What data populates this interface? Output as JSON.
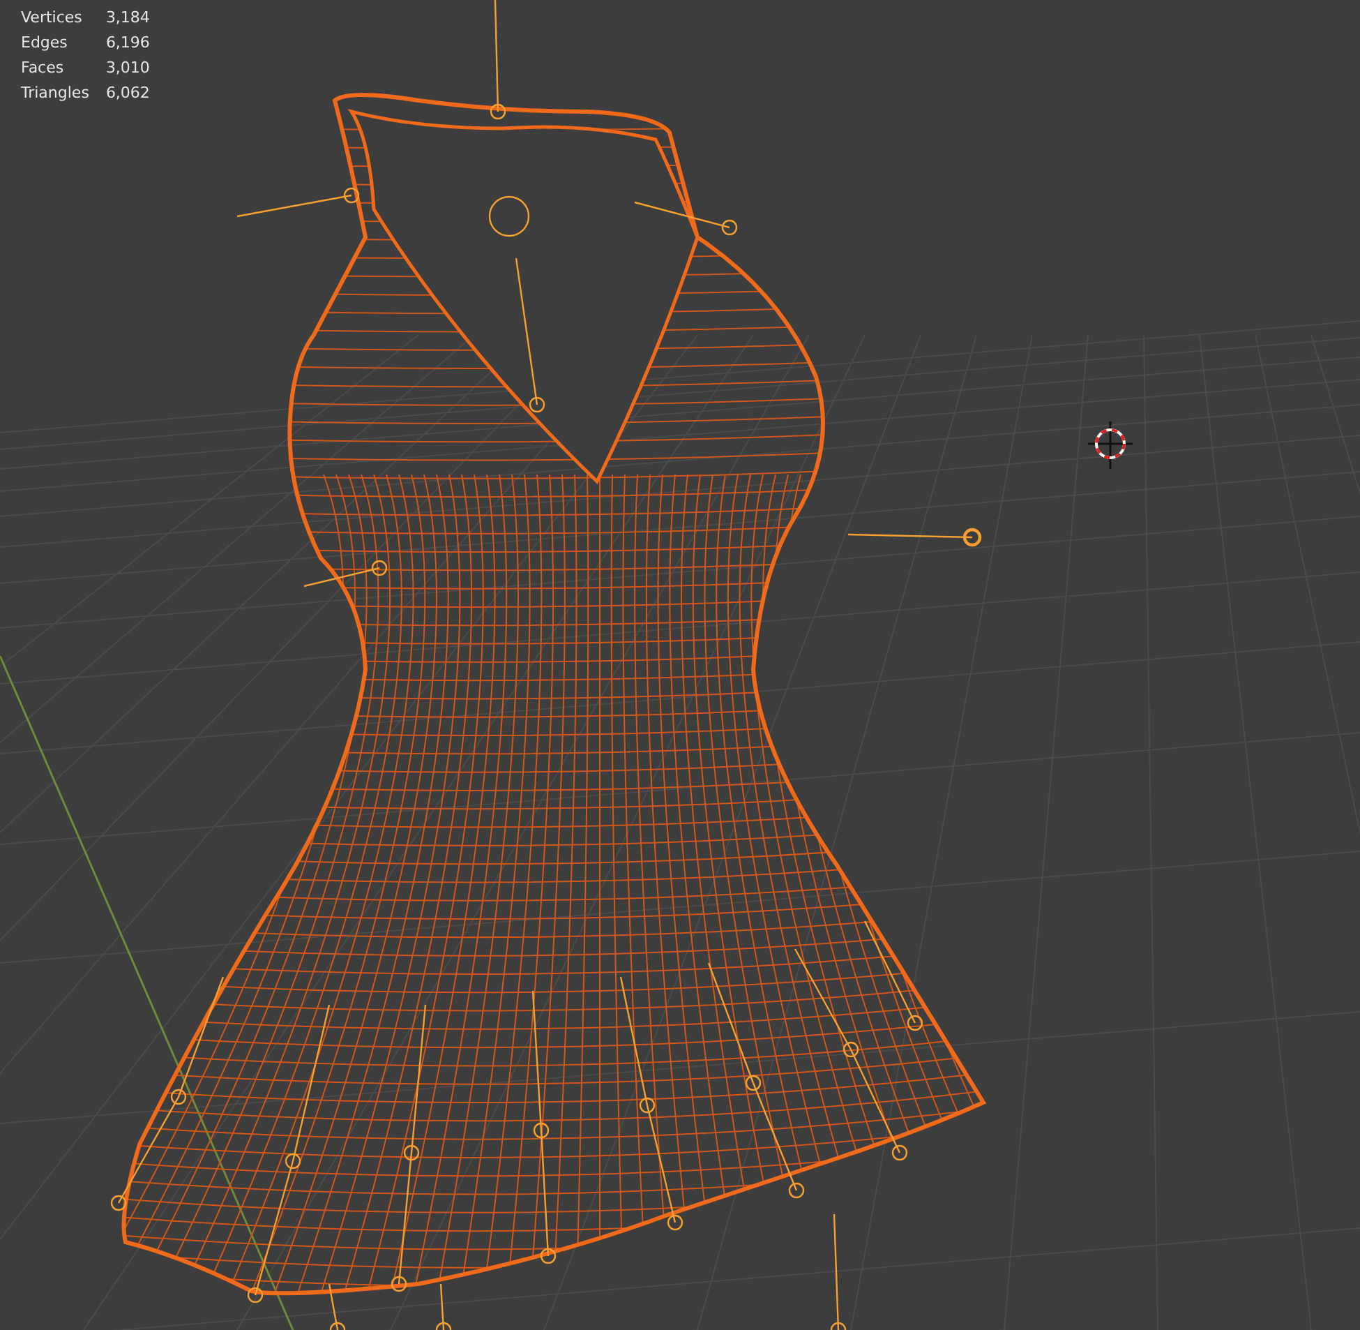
{
  "stats": [
    {
      "label": "Vertices",
      "value": "3,184"
    },
    {
      "label": "Edges",
      "value": "6,196"
    },
    {
      "label": "Faces",
      "value": "3,010"
    },
    {
      "label": "Triangles",
      "value": "6,062"
    }
  ]
}
